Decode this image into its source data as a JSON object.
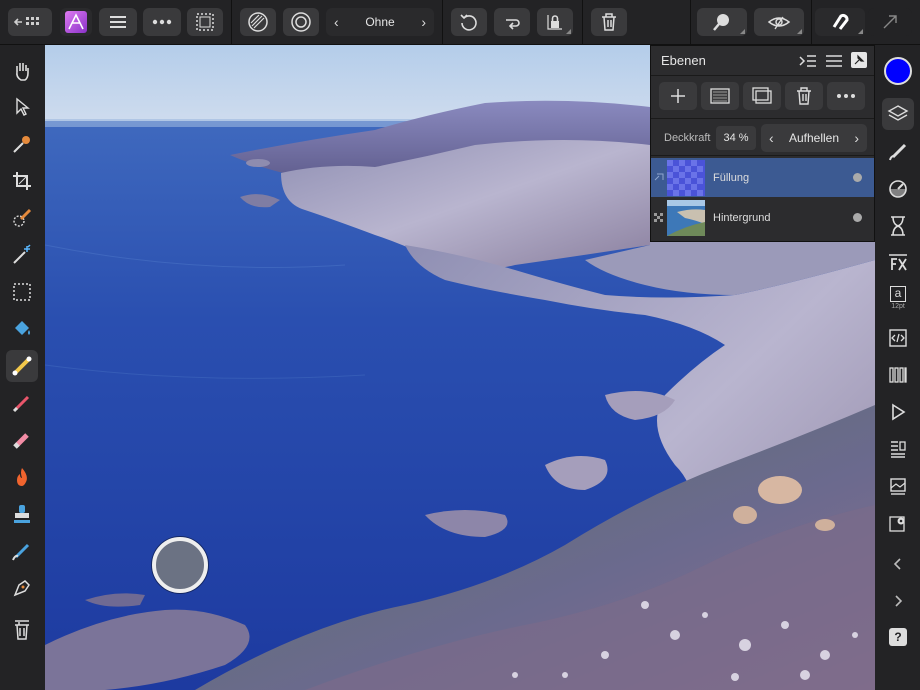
{
  "app": {
    "accent": "#c160e8"
  },
  "toolbar": {
    "back_icon": "back-grid-icon",
    "blend_prev": "‹",
    "blend_value": "Ohne",
    "blend_next": "›"
  },
  "layers_panel": {
    "title": "Ebenen",
    "opacity_label": "Deckkraft",
    "opacity_value": "34 %",
    "blend_prev": "‹",
    "blend_mode": "Aufhellen",
    "blend_next": "›",
    "layers": [
      {
        "name": "Füllung",
        "selected": true
      },
      {
        "name": "Hintergrund",
        "selected": false
      }
    ]
  },
  "color": {
    "primary": "#0000ff"
  },
  "text_tool": {
    "glyph": "a",
    "size_label": "12pt"
  },
  "help_label": "?"
}
